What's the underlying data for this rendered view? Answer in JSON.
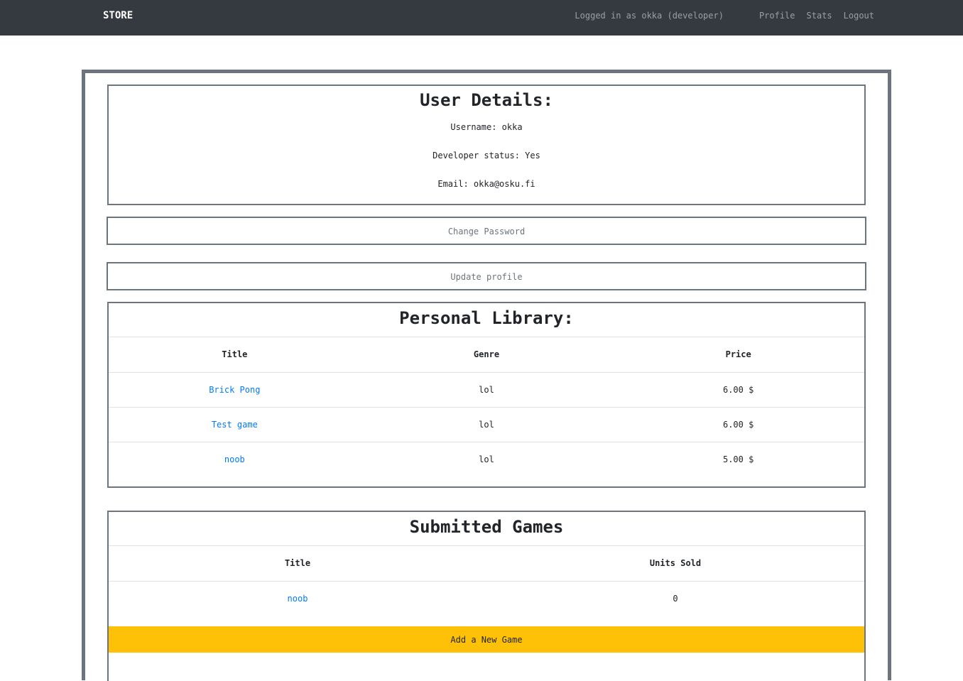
{
  "navbar": {
    "brand": "STORE",
    "status": "Logged in as okka (developer)",
    "links": [
      "Profile",
      "Stats",
      "Logout"
    ]
  },
  "user_details": {
    "title": "User Details:",
    "username": "Username: okka",
    "developer_status": "Developer status: Yes",
    "email": "Email: okka@osku.fi"
  },
  "buttons": {
    "change_password": "Change Password",
    "update_profile": "Update profile",
    "add_game": "Add a New Game"
  },
  "library": {
    "title": "Personal Library:",
    "headers": [
      "Title",
      "Genre",
      "Price"
    ],
    "rows": [
      {
        "title": "Brick Pong",
        "genre": "lol",
        "price": "6.00 $"
      },
      {
        "title": "Test game",
        "genre": "lol",
        "price": "6.00 $"
      },
      {
        "title": "noob",
        "genre": "lol",
        "price": "5.00 $"
      }
    ]
  },
  "submitted": {
    "title": "Submitted Games",
    "headers": [
      "Title",
      "Units Sold"
    ],
    "rows": [
      {
        "title": "noob",
        "units_sold": "0"
      }
    ]
  },
  "colors": {
    "navbar": "#343a40",
    "border": "#6c757d",
    "link": "#007bff",
    "warning": "#ffc107"
  }
}
